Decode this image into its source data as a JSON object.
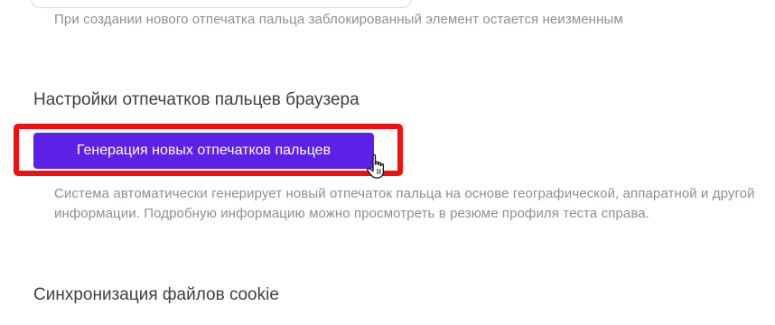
{
  "previous_setting": {
    "description": "При создании нового отпечатка пальца заблокированный элемент остается неизменным"
  },
  "fingerprint_settings": {
    "title": "Настройки отпечатков пальцев браузера",
    "generate_button_label": "Генерация новых отпечатков пальцев",
    "description": "Система автоматически генерирует новый отпечаток пальца на основе географической, аппаратной и другой информации. Подробную информацию можно просмотреть в резюме профиля теста справа."
  },
  "cookie_sync": {
    "title": "Синхронизация файлов cookie"
  },
  "colors": {
    "accent": "#5b21e6",
    "highlight": "#f11010",
    "muted_text": "#8a8f98",
    "title_text": "#3c3f45"
  },
  "icons": {
    "cursor": "hand-pointer-icon"
  }
}
